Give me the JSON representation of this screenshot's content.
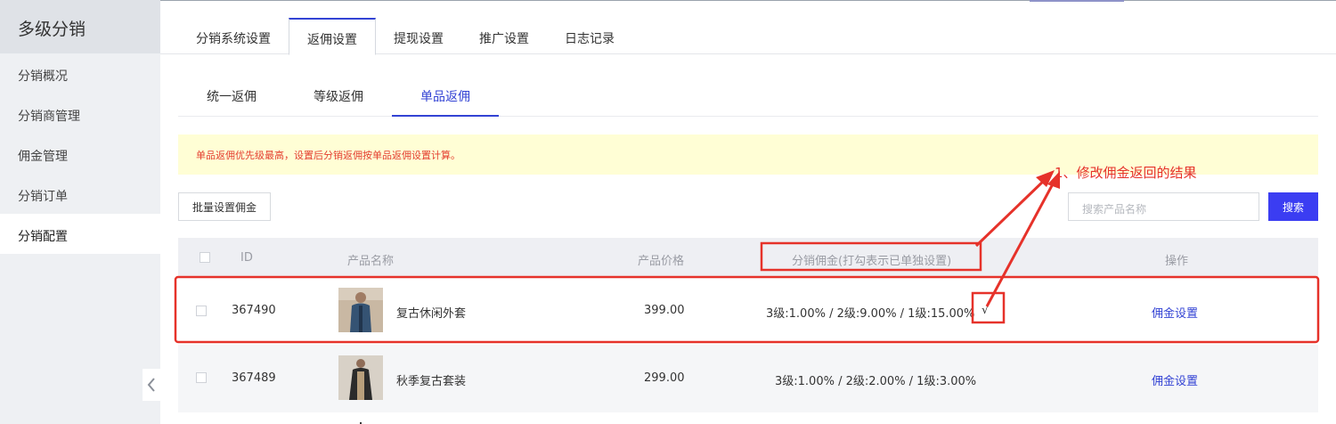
{
  "sidebar": {
    "title": "多级分销",
    "items": [
      {
        "label": "分销概况"
      },
      {
        "label": "分销商管理"
      },
      {
        "label": "佣金管理"
      },
      {
        "label": "分销订单"
      },
      {
        "label": "分销配置",
        "active": true
      }
    ]
  },
  "main_tabs": [
    {
      "label": "分销系统设置"
    },
    {
      "label": "返佣设置",
      "active": true
    },
    {
      "label": "提现设置"
    },
    {
      "label": "推广设置"
    },
    {
      "label": "日志记录"
    }
  ],
  "sub_tabs": [
    {
      "label": "统一返佣"
    },
    {
      "label": "等级返佣"
    },
    {
      "label": "单品返佣",
      "active": true
    }
  ],
  "notice": "单品返佣优先级最高，设置后分销返佣按单品返佣设置计算。",
  "toolbar": {
    "batch_label": "批量设置佣金",
    "search_placeholder": "搜索产品名称",
    "search_label": "搜索"
  },
  "table": {
    "headers": {
      "id": "ID",
      "name": "产品名称",
      "price": "产品价格",
      "commission": "分销佣金(打勾表示已单独设置)",
      "action": "操作"
    },
    "rows": [
      {
        "id": "367490",
        "name": "复古休闲外套",
        "price": "399.00",
        "commission": "3级:1.00% / 2级:9.00% / 1级:15.00%",
        "mark": "√",
        "action": "佣金设置"
      },
      {
        "id": "367489",
        "name": "秋季复古套装",
        "price": "299.00",
        "commission": "3级:1.00% / 2级:2.00% / 1级:3.00%",
        "mark": "",
        "action": "佣金设置"
      }
    ]
  },
  "annotation": {
    "text": "1、修改佣金返回的结果",
    "color": "#e6322a"
  },
  "colors": {
    "accent": "#3343d4",
    "search_button": "#3b3df2",
    "notice_bg": "#fffed5",
    "notice_text": "#e43d2f"
  }
}
